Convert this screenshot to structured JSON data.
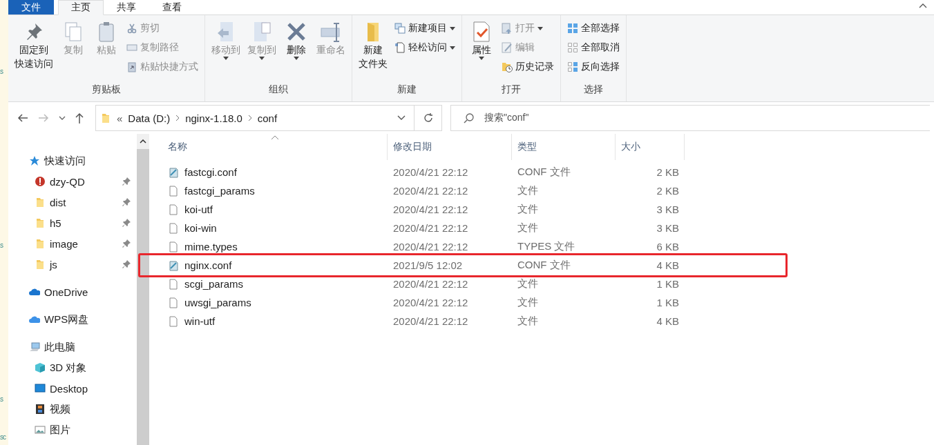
{
  "background_window": {
    "fragments": [
      "s",
      "s",
      "s",
      "sc"
    ]
  },
  "tabs": [
    {
      "label": "文件",
      "kind": "file",
      "selected": false
    },
    {
      "label": "主页",
      "kind": "tab",
      "selected": true
    },
    {
      "label": "共享",
      "kind": "tab",
      "selected": false
    },
    {
      "label": "查看",
      "kind": "tab",
      "selected": false
    }
  ],
  "ribbon": [
    {
      "label": "剪贴板",
      "columns": [
        [
          {
            "label": [
              "固定到",
              "快速访问"
            ],
            "kind": "large",
            "disabled": false,
            "dropdown": false
          }
        ],
        [
          {
            "label": "复制",
            "kind": "large",
            "disabled": true,
            "dropdown": false
          }
        ],
        [
          {
            "label": "粘贴",
            "kind": "large",
            "disabled": true,
            "dropdown": false
          }
        ],
        [
          {
            "label": "剪切",
            "kind": "small",
            "disabled": true,
            "dropdown": false
          },
          {
            "label": "复制路径",
            "kind": "small",
            "disabled": true,
            "dropdown": false
          },
          {
            "label": "粘贴快捷方式",
            "kind": "small",
            "disabled": true,
            "dropdown": false
          }
        ]
      ]
    },
    {
      "label": "组织",
      "columns": [
        [
          {
            "label": "移动到",
            "kind": "large",
            "disabled": true,
            "dropdown": true
          }
        ],
        [
          {
            "label": "复制到",
            "kind": "large",
            "disabled": true,
            "dropdown": true
          }
        ],
        [
          {
            "label": "删除",
            "kind": "large",
            "disabled": false,
            "dropdown": true
          }
        ],
        [
          {
            "label": "重命名",
            "kind": "large",
            "disabled": true,
            "dropdown": false
          }
        ]
      ]
    },
    {
      "label": "新建",
      "columns": [
        [
          {
            "label": [
              "新建",
              "文件夹"
            ],
            "kind": "large",
            "disabled": false,
            "dropdown": false
          }
        ],
        [
          {
            "label": "新建项目",
            "kind": "small",
            "disabled": false,
            "dropdown": true
          },
          {
            "label": "轻松访问",
            "kind": "small",
            "disabled": false,
            "dropdown": true
          }
        ]
      ]
    },
    {
      "label": "打开",
      "columns": [
        [
          {
            "label": "属性",
            "kind": "large",
            "disabled": false,
            "dropdown": true
          }
        ],
        [
          {
            "label": "打开",
            "kind": "small",
            "disabled": true,
            "dropdown": true
          },
          {
            "label": "编辑",
            "kind": "small",
            "disabled": true,
            "dropdown": false
          },
          {
            "label": "历史记录",
            "kind": "small",
            "disabled": false,
            "dropdown": false
          }
        ]
      ]
    },
    {
      "label": "选择",
      "columns": [
        [
          {
            "label": "全部选择",
            "kind": "small",
            "disabled": false,
            "dropdown": false
          },
          {
            "label": "全部取消",
            "kind": "small",
            "disabled": false,
            "dropdown": false
          },
          {
            "label": "反向选择",
            "kind": "small",
            "disabled": false,
            "dropdown": false
          }
        ]
      ]
    }
  ],
  "navigation": {
    "back_disabled": false,
    "forward_disabled": true
  },
  "address_bar": {
    "overflow": "«",
    "segments": [
      "Data (D:)",
      "nginx-1.18.0",
      "conf"
    ]
  },
  "search": {
    "placeholder": "搜索\"conf\""
  },
  "sidebar": [
    {
      "label": "快速访问",
      "children": [
        {
          "label": "dzy-QD",
          "pinned": true
        },
        {
          "label": "dist",
          "pinned": true
        },
        {
          "label": "h5",
          "pinned": true
        },
        {
          "label": "image",
          "pinned": true
        },
        {
          "label": "js",
          "pinned": true
        }
      ]
    },
    {
      "label": "OneDrive"
    },
    {
      "label": "WPS网盘"
    },
    {
      "label": "此电脑",
      "children": [
        {
          "label": "3D 对象"
        },
        {
          "label": "Desktop"
        },
        {
          "label": "视频"
        },
        {
          "label": "图片"
        }
      ]
    }
  ],
  "table": {
    "columns": [
      "名称",
      "修改日期",
      "类型",
      "大小"
    ],
    "rows": [
      {
        "name": "fastcgi.conf",
        "kind": "conf",
        "modified": "2020/4/21 22:12",
        "type": "CONF 文件",
        "size": "2 KB",
        "highlighted": false
      },
      {
        "name": "fastcgi_params",
        "kind": "plain",
        "modified": "2020/4/21 22:12",
        "type": "文件",
        "size": "2 KB",
        "highlighted": false
      },
      {
        "name": "koi-utf",
        "kind": "plain",
        "modified": "2020/4/21 22:12",
        "type": "文件",
        "size": "3 KB",
        "highlighted": false
      },
      {
        "name": "koi-win",
        "kind": "plain",
        "modified": "2020/4/21 22:12",
        "type": "文件",
        "size": "3 KB",
        "highlighted": false
      },
      {
        "name": "mime.types",
        "kind": "plain",
        "modified": "2020/4/21 22:12",
        "type": "TYPES 文件",
        "size": "6 KB",
        "highlighted": false
      },
      {
        "name": "nginx.conf",
        "kind": "conf",
        "modified": "2021/9/5 12:02",
        "type": "CONF 文件",
        "size": "4 KB",
        "highlighted": true
      },
      {
        "name": "scgi_params",
        "kind": "plain",
        "modified": "2020/4/21 22:12",
        "type": "文件",
        "size": "1 KB",
        "highlighted": false
      },
      {
        "name": "uwsgi_params",
        "kind": "plain",
        "modified": "2020/4/21 22:12",
        "type": "文件",
        "size": "1 KB",
        "highlighted": false
      },
      {
        "name": "win-utf",
        "kind": "plain",
        "modified": "2020/4/21 22:12",
        "type": "文件",
        "size": "4 KB",
        "highlighted": false
      }
    ]
  }
}
